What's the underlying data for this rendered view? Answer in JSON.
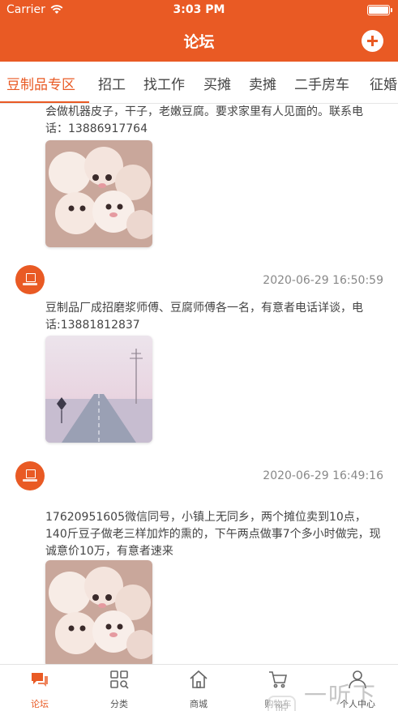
{
  "status_bar": {
    "carrier": "Carrier",
    "time": "3:03 PM"
  },
  "nav": {
    "title": "论坛"
  },
  "tabs": [
    {
      "label": "豆制品专区",
      "active": true
    },
    {
      "label": "招工"
    },
    {
      "label": "找工作"
    },
    {
      "label": "买摊"
    },
    {
      "label": "卖摊"
    },
    {
      "label": "二手房车"
    },
    {
      "label": "征婚"
    }
  ],
  "posts": [
    {
      "text": "会做机器皮子，干子，老嫩豆腐。要求家里有人见面的。联系电话：13886917764",
      "image": "marshmallow-faces"
    },
    {
      "timestamp": "2020-06-29 16:50:59",
      "text": "豆制品厂成招磨浆师傅、豆腐师傅各一名，有意者电话详谈，电话:13881812837",
      "image": "pink-road"
    },
    {
      "timestamp": "2020-06-29 16:49:16",
      "text": "17620951605微信同号，小镇上无同乡，两个摊位卖到10点，140斤豆子做老三样加炸的熏的，下午两点做事7个多小时做完，现诚意价10万，有意者速来",
      "image": "marshmallow-faces"
    }
  ],
  "tabbar": [
    {
      "label": "论坛",
      "icon": "chat-bubbles-icon",
      "active": true
    },
    {
      "label": "分类",
      "icon": "grid-search-icon"
    },
    {
      "label": "商城",
      "icon": "home-icon"
    },
    {
      "label": "购物车",
      "icon": "cart-icon"
    },
    {
      "label": "个人中心",
      "icon": "person-icon"
    }
  ],
  "watermark": {
    "text": "一听下载"
  },
  "colors": {
    "accent": "#e95a24",
    "text": "#444444",
    "muted": "#888888"
  }
}
